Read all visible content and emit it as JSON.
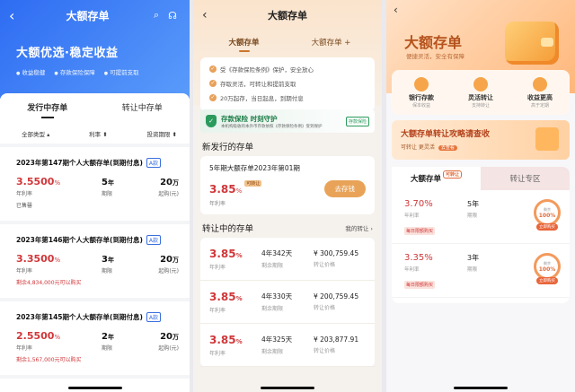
{
  "p1": {
    "title": "大额存单",
    "slogan": "大额优选·稳定收益",
    "features": [
      "收益稳健",
      "存款保险保障",
      "可提前支取"
    ],
    "tabs": [
      "发行中存单",
      "转让中存单"
    ],
    "filters": [
      "全部类型 ▴",
      "利率 ⬍",
      "投资期限 ⬍"
    ],
    "products": [
      {
        "name": "2023年第147期个人大额存单(到期付息)",
        "badge": "A款",
        "rate": "3.5500",
        "rate_unit": "%",
        "term": "5",
        "term_unit": "年",
        "min": "20",
        "min_unit": "万",
        "rate_label": "年利率",
        "term_label": "期限",
        "min_label": "起购(元)",
        "status": "已售罄"
      },
      {
        "name": "2023年第146期个人大额存单(到期付息)",
        "badge": "A款",
        "rate": "3.3500",
        "rate_unit": "%",
        "term": "3",
        "term_unit": "年",
        "min": "20",
        "min_unit": "万",
        "rate_label": "年利率",
        "term_label": "期限",
        "min_label": "起购(元)",
        "status": "剩余4,834,000元可以购买"
      },
      {
        "name": "2023年第145期个人大额存单(到期付息)",
        "badge": "A款",
        "rate": "2.5500",
        "rate_unit": "%",
        "term": "2",
        "term_unit": "年",
        "min": "20",
        "min_unit": "万",
        "rate_label": "年利率",
        "term_label": "期限",
        "min_label": "起购(元)",
        "status": "剩余1,567,000元可以购买"
      }
    ]
  },
  "p2": {
    "title": "大额存单",
    "tabs": [
      "大额存单",
      "大额存单 +"
    ],
    "benefits": [
      "受《存款保险条例》保护，安全放心",
      "存取灵活，可转让和提前支取",
      "20万起存，当日起息，到期付息"
    ],
    "banner_title": "存款保险 时刻守护",
    "banner_sub": "本机构吸收的本外币存款依照《存款保险条例》受到保护",
    "banner_logo": "存款保险",
    "new_section": "新发行的存单",
    "new_product": {
      "name": "5年期大额存单2023年第01期",
      "rate": "3.85",
      "rate_unit": "%",
      "tag": "可转让",
      "rate_label": "年利率",
      "button": "去存钱"
    },
    "transfer_section": "转让中的存单",
    "transfer_link": "我的转让 ›",
    "transfers": [
      {
        "rate": "3.85",
        "unit": "%",
        "rate_label": "年利率",
        "remain": "4年342天",
        "remain_label": "剩余期限",
        "price": "¥ 300,759.45",
        "price_label": "转让价格"
      },
      {
        "rate": "3.85",
        "unit": "%",
        "rate_label": "年利率",
        "remain": "4年330天",
        "remain_label": "剩余期限",
        "price": "¥ 200,759.45",
        "price_label": "转让价格"
      },
      {
        "rate": "3.85",
        "unit": "%",
        "rate_label": "年利率",
        "remain": "4年325天",
        "remain_label": "剩余期限",
        "price": "¥ 203,877.91",
        "price_label": "转让价格"
      }
    ]
  },
  "p3": {
    "title": "大额存单",
    "subtitle": "便捷灵活，安全有保障",
    "features": [
      {
        "title": "银行存款",
        "sub": "保本收益"
      },
      {
        "title": "灵活转让",
        "sub": "支持转让"
      },
      {
        "title": "收益更高",
        "sub": "高于定期"
      }
    ],
    "banner_title": "大额存单转让攻略请查收",
    "banner_sub": "可转让 更灵活",
    "banner_btn": "去查看",
    "tabs": [
      "大额存单",
      "转让专区"
    ],
    "tab_tag": "可转让",
    "items": [
      {
        "rate": "3.70%",
        "rate_label": "年利率",
        "term": "5年",
        "term_label": "期限",
        "tag": "每日限额购买",
        "ring_top": "剩余",
        "ring_pct": "100%",
        "buy": "立即购买"
      },
      {
        "rate": "3.35%",
        "rate_label": "年利率",
        "term": "3年",
        "term_label": "期限",
        "tag": "每日限额购买",
        "ring_top": "剩余",
        "ring_pct": "100%",
        "buy": "立即购买"
      }
    ]
  }
}
